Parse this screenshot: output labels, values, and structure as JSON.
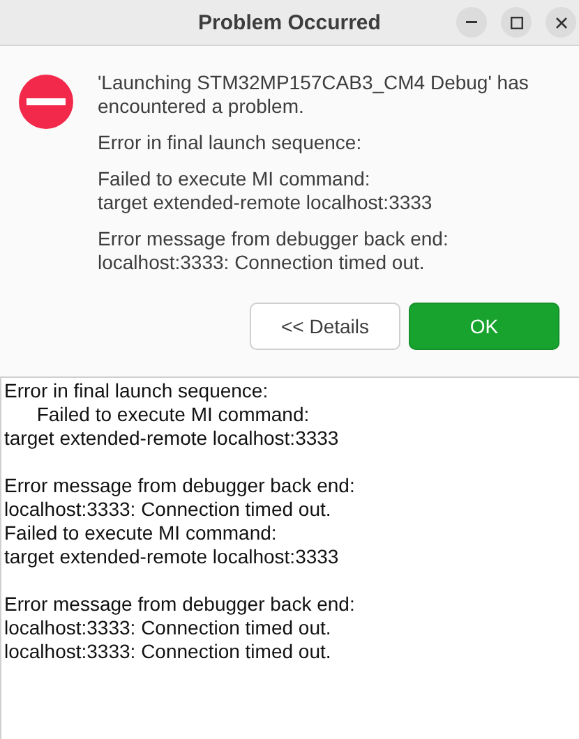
{
  "window": {
    "title": "Problem Occurred",
    "controls": [
      {
        "kind": "minimize"
      },
      {
        "kind": "maximize"
      },
      {
        "kind": "close"
      }
    ]
  },
  "message": {
    "paragraphs": [
      {
        "lines": [
          "'Launching STM32MP157CAB3_CM4 Debug' has encountered a problem."
        ]
      },
      {
        "lines": [
          "Error in final launch sequence:"
        ]
      },
      {
        "lines": [
          "Failed to execute MI command:",
          "target extended-remote localhost:3333"
        ]
      },
      {
        "lines": [
          "Error message from debugger back end:",
          "localhost:3333: Connection timed out."
        ]
      }
    ]
  },
  "buttons": [
    {
      "label": "<< Details",
      "kind": "secondary"
    },
    {
      "label": "OK",
      "kind": "primary"
    }
  ],
  "details": {
    "paragraphs": [
      {
        "lines": [
          "Error in final launch sequence:",
          "      Failed to execute MI command:",
          "target extended-remote localhost:3333"
        ]
      },
      {
        "lines": [
          "Error message from debugger back end:",
          "localhost:3333: Connection timed out.",
          "Failed to execute MI command:",
          "target extended-remote localhost:3333"
        ]
      },
      {
        "lines": [
          "Error message from debugger back end:",
          "localhost:3333: Connection timed out.",
          "localhost:3333: Connection timed out."
        ]
      }
    ]
  }
}
